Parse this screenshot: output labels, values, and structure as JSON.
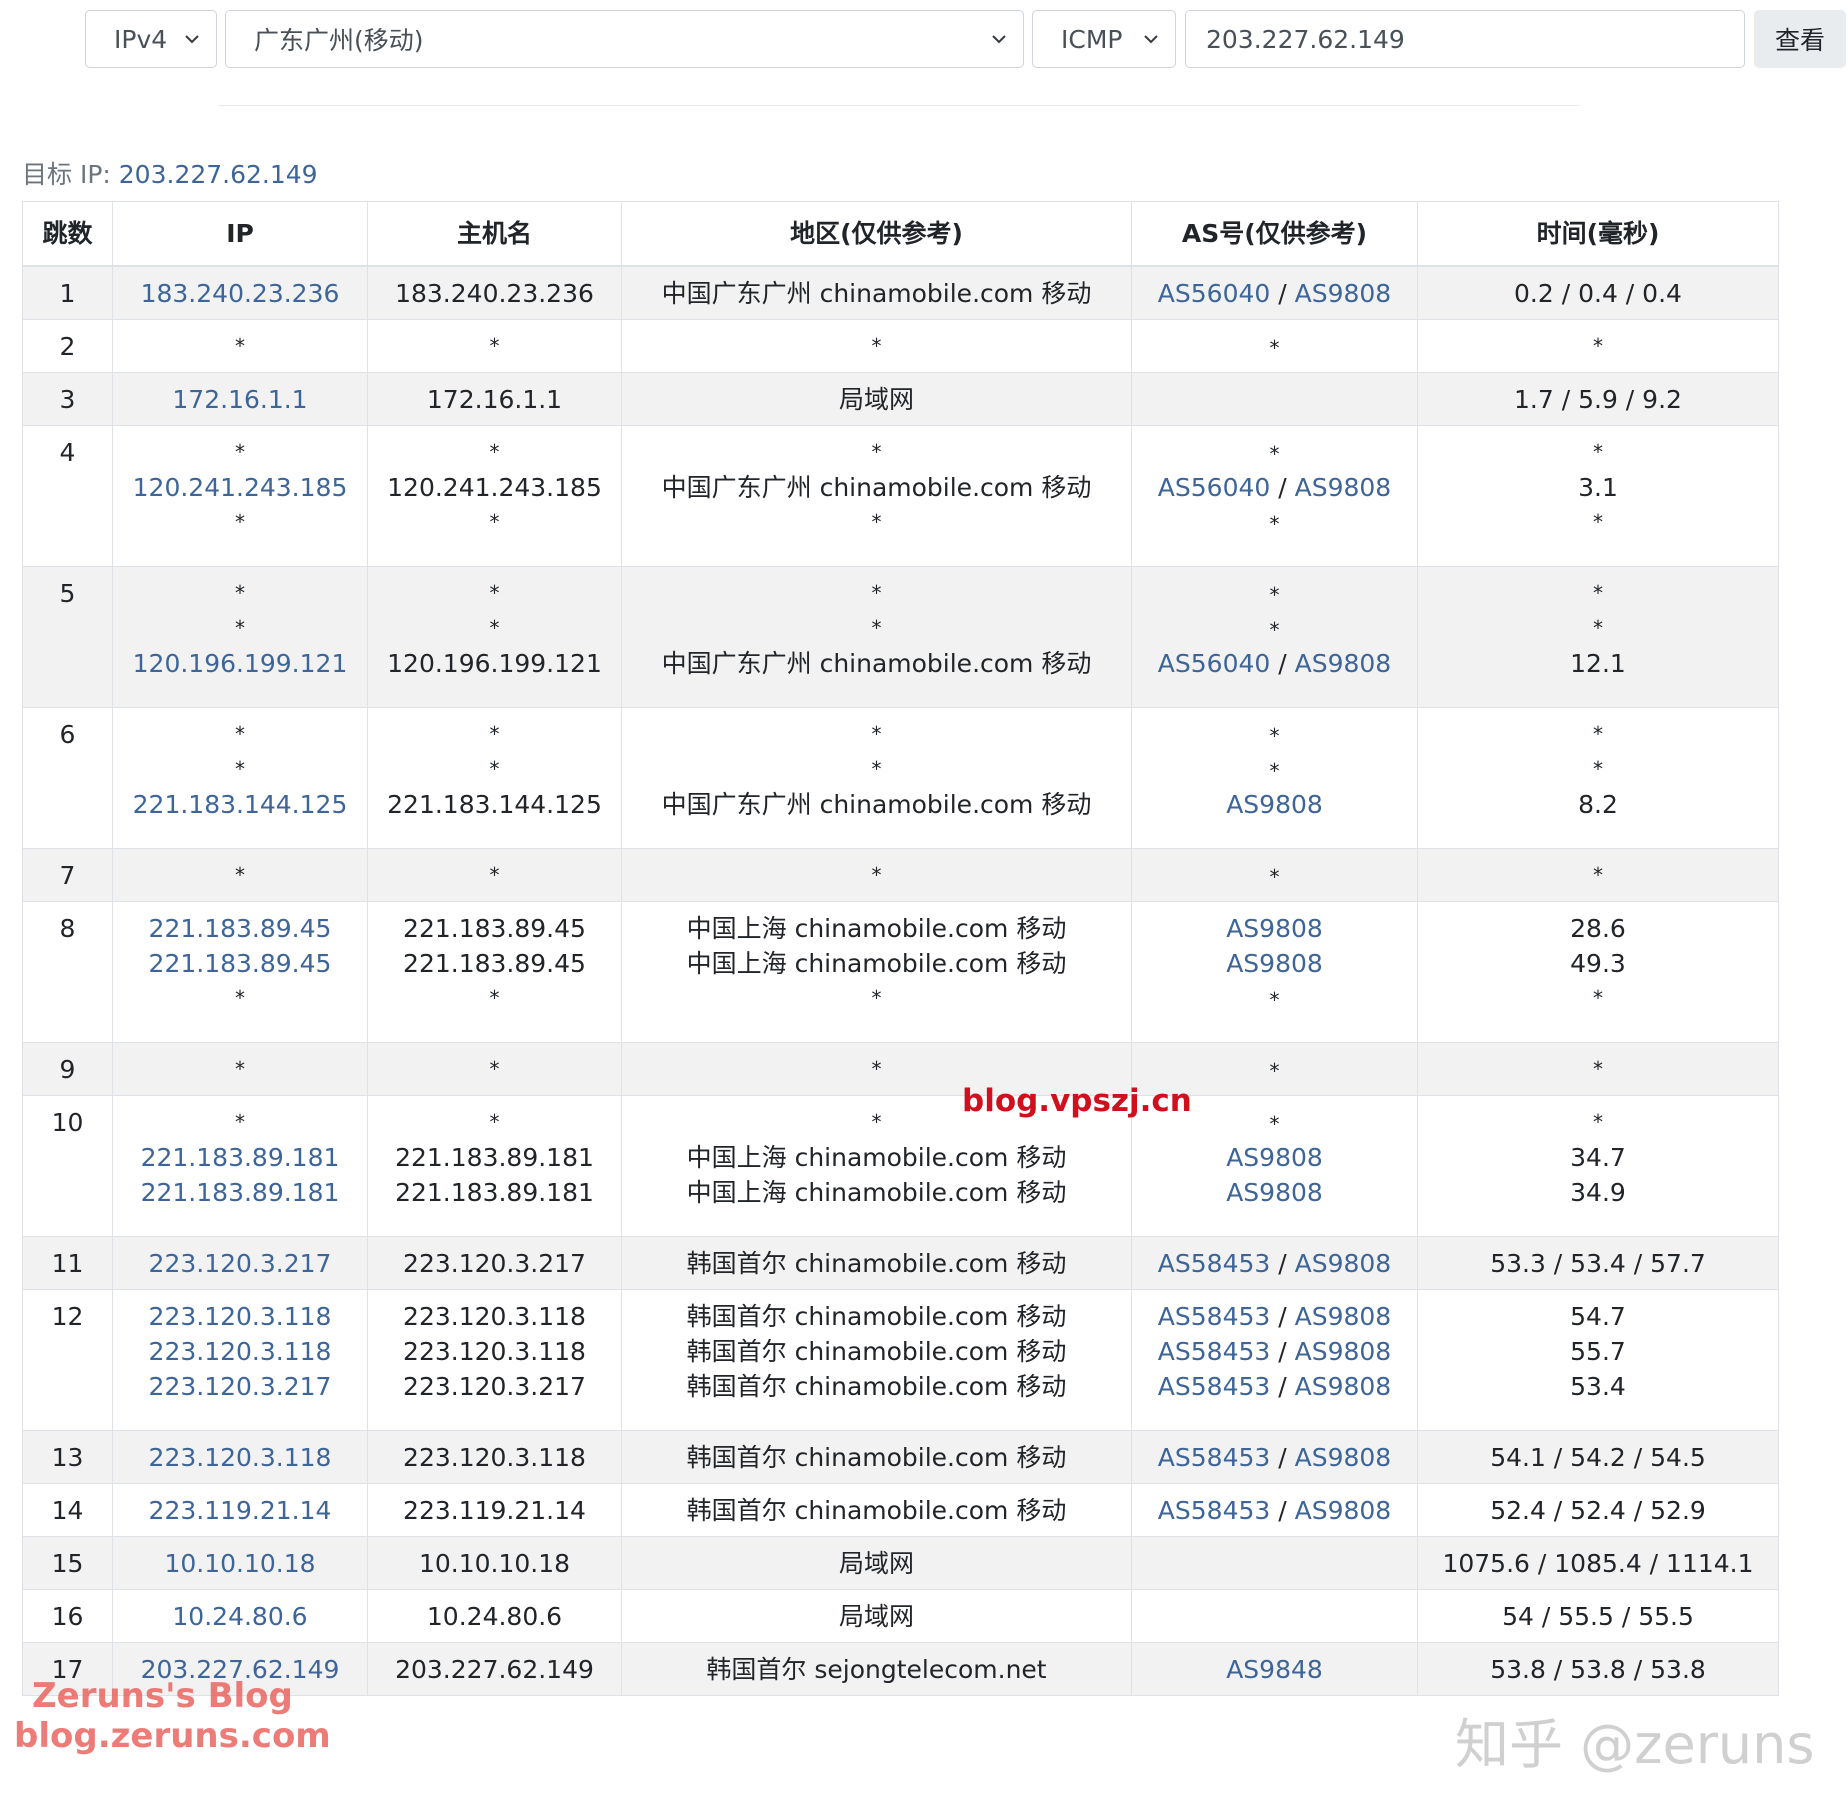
{
  "form": {
    "ip_version": "IPv4",
    "location": "广东广州(移动)",
    "protocol": "ICMP",
    "ip_value": "203.227.62.149",
    "query_button": "查看"
  },
  "target": {
    "label": "目标 IP:",
    "ip": "203.227.62.149"
  },
  "table": {
    "headers": [
      "跳数",
      "IP",
      "主机名",
      "地区(仅供参考)",
      "AS号(仅供参考)",
      "时间(毫秒)"
    ]
  },
  "hops": [
    {
      "hop": "1",
      "lines": [
        {
          "ip": "183.240.23.236",
          "host": "183.240.23.236",
          "region": "中国广东广州 chinamobile.com 移动",
          "as": [
            "AS56040",
            "AS9808"
          ],
          "time": "0.2 / 0.4 / 0.4"
        }
      ]
    },
    {
      "hop": "2",
      "lines": [
        {
          "ip": "*",
          "host": "*",
          "region": "*",
          "as": [
            "*"
          ],
          "time": "*"
        }
      ]
    },
    {
      "hop": "3",
      "lines": [
        {
          "ip": "172.16.1.1",
          "host": "172.16.1.1",
          "region": "局域网",
          "as": [],
          "time": "1.7 / 5.9 / 9.2"
        }
      ]
    },
    {
      "hop": "4",
      "lines": [
        {
          "ip": "*",
          "host": "*",
          "region": "*",
          "as": [
            "*"
          ],
          "time": "*"
        },
        {
          "ip": "120.241.243.185",
          "host": "120.241.243.185",
          "region": "中国广东广州 chinamobile.com 移动",
          "as": [
            "AS56040",
            "AS9808"
          ],
          "time": "3.1"
        },
        {
          "ip": "*",
          "host": "*",
          "region": "*",
          "as": [
            "*"
          ],
          "time": "*"
        }
      ]
    },
    {
      "hop": "5",
      "lines": [
        {
          "ip": "*",
          "host": "*",
          "region": "*",
          "as": [
            "*"
          ],
          "time": "*"
        },
        {
          "ip": "*",
          "host": "*",
          "region": "*",
          "as": [
            "*"
          ],
          "time": "*"
        },
        {
          "ip": "120.196.199.121",
          "host": "120.196.199.121",
          "region": "中国广东广州 chinamobile.com 移动",
          "as": [
            "AS56040",
            "AS9808"
          ],
          "time": "12.1"
        }
      ]
    },
    {
      "hop": "6",
      "lines": [
        {
          "ip": "*",
          "host": "*",
          "region": "*",
          "as": [
            "*"
          ],
          "time": "*"
        },
        {
          "ip": "*",
          "host": "*",
          "region": "*",
          "as": [
            "*"
          ],
          "time": "*"
        },
        {
          "ip": "221.183.144.125",
          "host": "221.183.144.125",
          "region": "中国广东广州 chinamobile.com 移动",
          "as": [
            "AS9808"
          ],
          "time": "8.2"
        }
      ]
    },
    {
      "hop": "7",
      "lines": [
        {
          "ip": "*",
          "host": "*",
          "region": "*",
          "as": [
            "*"
          ],
          "time": "*"
        }
      ]
    },
    {
      "hop": "8",
      "lines": [
        {
          "ip": "221.183.89.45",
          "host": "221.183.89.45",
          "region": "中国上海 chinamobile.com 移动",
          "as": [
            "AS9808"
          ],
          "time": "28.6"
        },
        {
          "ip": "221.183.89.45",
          "host": "221.183.89.45",
          "region": "中国上海 chinamobile.com 移动",
          "as": [
            "AS9808"
          ],
          "time": "49.3"
        },
        {
          "ip": "*",
          "host": "*",
          "region": "*",
          "as": [
            "*"
          ],
          "time": "*"
        }
      ]
    },
    {
      "hop": "9",
      "lines": [
        {
          "ip": "*",
          "host": "*",
          "region": "*",
          "as": [
            "*"
          ],
          "time": "*"
        }
      ]
    },
    {
      "hop": "10",
      "lines": [
        {
          "ip": "*",
          "host": "*",
          "region": "*",
          "as": [
            "*"
          ],
          "time": "*"
        },
        {
          "ip": "221.183.89.181",
          "host": "221.183.89.181",
          "region": "中国上海 chinamobile.com 移动",
          "as": [
            "AS9808"
          ],
          "time": "34.7"
        },
        {
          "ip": "221.183.89.181",
          "host": "221.183.89.181",
          "region": "中国上海 chinamobile.com 移动",
          "as": [
            "AS9808"
          ],
          "time": "34.9"
        }
      ]
    },
    {
      "hop": "11",
      "lines": [
        {
          "ip": "223.120.3.217",
          "host": "223.120.3.217",
          "region": "韩国首尔 chinamobile.com 移动",
          "as": [
            "AS58453",
            "AS9808"
          ],
          "time": "53.3 / 53.4 / 57.7"
        }
      ]
    },
    {
      "hop": "12",
      "lines": [
        {
          "ip": "223.120.3.118",
          "host": "223.120.3.118",
          "region": "韩国首尔 chinamobile.com 移动",
          "as": [
            "AS58453",
            "AS9808"
          ],
          "time": "54.7"
        },
        {
          "ip": "223.120.3.118",
          "host": "223.120.3.118",
          "region": "韩国首尔 chinamobile.com 移动",
          "as": [
            "AS58453",
            "AS9808"
          ],
          "time": "55.7"
        },
        {
          "ip": "223.120.3.217",
          "host": "223.120.3.217",
          "region": "韩国首尔 chinamobile.com 移动",
          "as": [
            "AS58453",
            "AS9808"
          ],
          "time": "53.4"
        }
      ]
    },
    {
      "hop": "13",
      "lines": [
        {
          "ip": "223.120.3.118",
          "host": "223.120.3.118",
          "region": "韩国首尔 chinamobile.com 移动",
          "as": [
            "AS58453",
            "AS9808"
          ],
          "time": "54.1 / 54.2 / 54.5"
        }
      ]
    },
    {
      "hop": "14",
      "lines": [
        {
          "ip": "223.119.21.14",
          "host": "223.119.21.14",
          "region": "韩国首尔 chinamobile.com 移动",
          "as": [
            "AS58453",
            "AS9808"
          ],
          "time": "52.4 / 52.4 / 52.9"
        }
      ]
    },
    {
      "hop": "15",
      "lines": [
        {
          "ip": "10.10.10.18",
          "host": "10.10.10.18",
          "region": "局域网",
          "as": [],
          "time": "1075.6 / 1085.4 / 1114.1"
        }
      ]
    },
    {
      "hop": "16",
      "lines": [
        {
          "ip": "10.24.80.6",
          "host": "10.24.80.6",
          "region": "局域网",
          "as": [],
          "time": "54 / 55.5 / 55.5"
        }
      ]
    },
    {
      "hop": "17",
      "lines": [
        {
          "ip": "203.227.62.149",
          "host": "203.227.62.149",
          "region": "韩国首尔 sejongtelecom.net",
          "as": [
            "AS9848"
          ],
          "time": "53.8 / 53.8 / 53.8"
        }
      ]
    }
  ],
  "watermarks": {
    "center": "blog.vpszj.cn",
    "blog_title": "Zeruns's Blog",
    "blog_url": "blog.zeruns.com",
    "zhihu": "知乎 @zeruns"
  }
}
